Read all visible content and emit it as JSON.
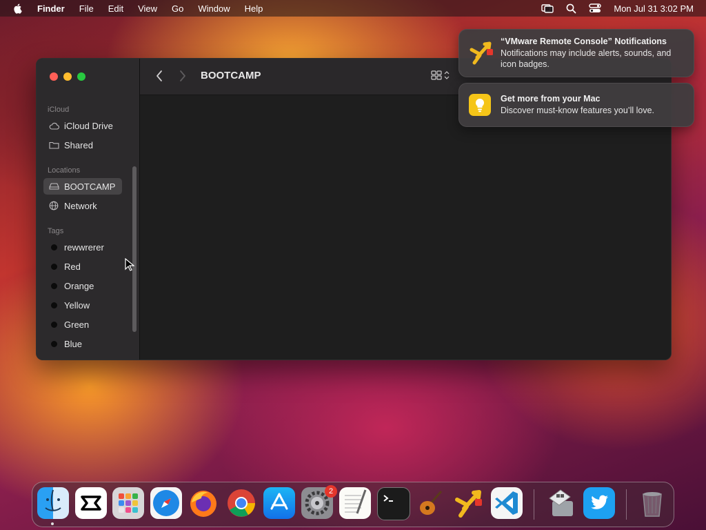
{
  "menubar": {
    "app_name": "Finder",
    "menus": [
      "File",
      "Edit",
      "View",
      "Go",
      "Window",
      "Help"
    ],
    "clock": "Mon Jul 31  3:02 PM"
  },
  "finder": {
    "title": "BOOTCAMP",
    "sidebar": {
      "icloud_label": "iCloud",
      "icloud_items": [
        "iCloud Drive",
        "Shared"
      ],
      "locations_label": "Locations",
      "location_items": [
        "BOOTCAMP",
        "Network"
      ],
      "tags_label": "Tags",
      "tag_items": [
        "rewwrerer",
        "Red",
        "Orange",
        "Yellow",
        "Green",
        "Blue"
      ]
    }
  },
  "notifications": [
    {
      "title": "“VMware Remote Console” Notifications",
      "body": "Notifications may include alerts, sounds, and icon badges.",
      "icon": "vmware-icon"
    },
    {
      "title": "Get more from your Mac",
      "body": "Discover must-know features you’ll love.",
      "icon": "tips-icon"
    }
  ],
  "dock": {
    "items": [
      "Finder",
      "CapCut",
      "Launchpad",
      "Safari",
      "Firefox",
      "Chrome",
      "App Store",
      "System Settings",
      "TextEdit",
      "Terminal",
      "GarageBand",
      "VMware Remote Console",
      "Visual Studio Code",
      "Boot Camp Assistant",
      "Twitter",
      "Trash"
    ],
    "system_settings_badge": "2"
  }
}
